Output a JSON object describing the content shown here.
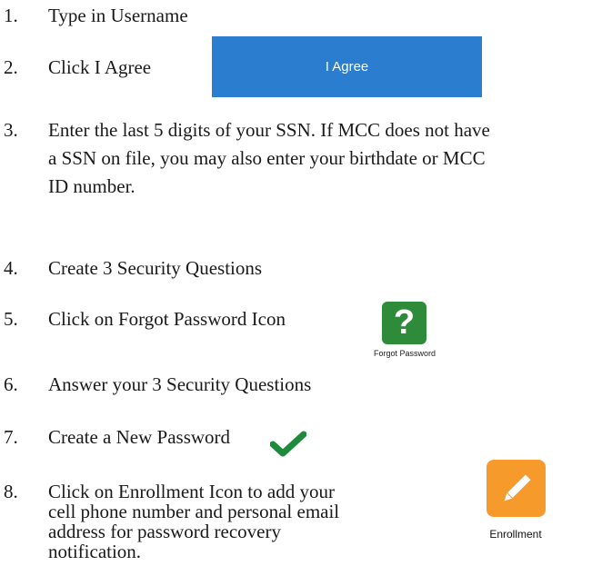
{
  "steps": [
    {
      "number": "1.",
      "lines": [
        "Type in Username"
      ]
    },
    {
      "number": "2.",
      "lines": [
        "Click I Agree"
      ]
    },
    {
      "number": "3.",
      "lines": [
        "Enter the last 5 digits of your SSN. If MCC does not have",
        "a SSN on file, you may also enter your birthdate or MCC",
        "ID number."
      ]
    },
    {
      "number": "4.",
      "lines": [
        "Create 3 Security Questions"
      ]
    },
    {
      "number": "5.",
      "lines": [
        "Click on Forgot Password Icon"
      ]
    },
    {
      "number": "6.",
      "lines": [
        "Answer your 3 Security Questions"
      ]
    },
    {
      "number": "7.",
      "lines": [
        "Create a New Password"
      ]
    },
    {
      "number": "8.",
      "lines": [
        "Click on Enrollment Icon to add your",
        "cell phone number and personal email",
        "address for password recovery",
        "notification."
      ]
    }
  ],
  "agree_button": {
    "label": "I Agree",
    "color": "#2b7dcf"
  },
  "forgot_icon": {
    "glyph": "?",
    "caption": "Forgot Password",
    "icon": "question-mark-icon",
    "color": "#2e8b3a"
  },
  "check_icon": {
    "icon": "checkmark-icon",
    "color": "#1e8a3c"
  },
  "enrollment_icon": {
    "caption": "Enrollment",
    "icon": "pencil-icon",
    "color": "#f69a2c"
  }
}
